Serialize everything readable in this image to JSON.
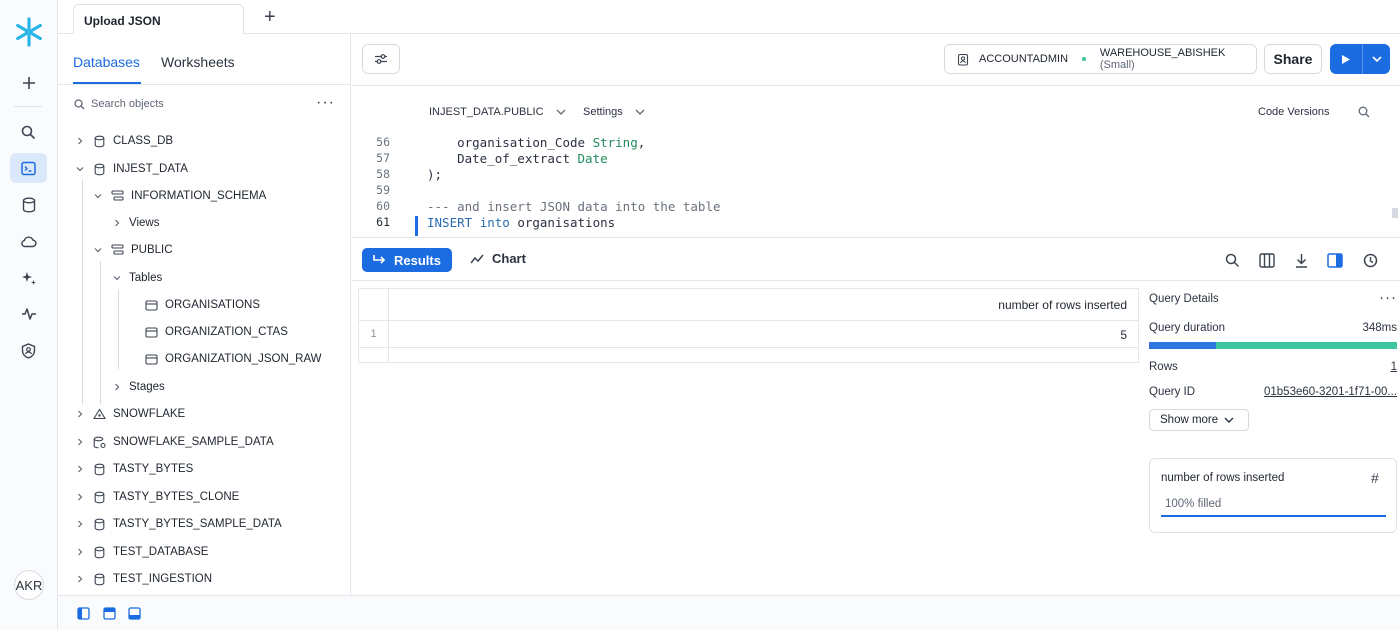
{
  "tab": {
    "title": "Upload JSON",
    "add": "+"
  },
  "panel": {
    "tabs": {
      "databases": "Databases",
      "worksheets": "Worksheets"
    },
    "search_placeholder": "Search objects",
    "more": "···",
    "tree": {
      "class_db": "CLASS_DB",
      "injest_data": "INJEST_DATA",
      "information_schema": "INFORMATION_SCHEMA",
      "views": "Views",
      "public": "PUBLIC",
      "tables": "Tables",
      "organisations": "ORGANISATIONS",
      "organization_ctas": "ORGANIZATION_CTAS",
      "organization_json_raw": "ORGANIZATION_JSON_RAW",
      "stages": "Stages",
      "snowflake": "SNOWFLAKE",
      "snowflake_sample_data": "SNOWFLAKE_SAMPLE_DATA",
      "tasty_bytes": "TASTY_BYTES",
      "tasty_bytes_clone": "TASTY_BYTES_CLONE",
      "tasty_bytes_sample_data": "TASTY_BYTES_SAMPLE_DATA",
      "test_database": "TEST_DATABASE",
      "test_ingestion": "TEST_INGESTION"
    }
  },
  "user": {
    "initials": "AKR"
  },
  "toolbar": {
    "role": "ACCOUNTADMIN",
    "warehouse": "WAREHOUSE_ABISHEK",
    "warehouse_size": "(Small)",
    "share": "Share"
  },
  "editor": {
    "context": "INJEST_DATA.PUBLIC",
    "settings": "Settings",
    "code_versions": "Code Versions",
    "lines": [
      {
        "num": "56",
        "a": "    organisation_Code ",
        "b": "String",
        "c": ","
      },
      {
        "num": "57",
        "a": "    Date_of_extract ",
        "b": "Date",
        "c": ""
      },
      {
        "num": "58",
        "text": ");"
      },
      {
        "num": "59",
        "text": ""
      },
      {
        "num": "60",
        "comment": "--- and insert JSON data into the table"
      },
      {
        "num": "61",
        "kw1": "INSERT",
        "kw2": "into",
        "rest": "organisations"
      }
    ]
  },
  "results": {
    "results_label": "Results",
    "chart_label": "Chart",
    "column_header": "number of rows inserted",
    "row_index": "1",
    "row_value": "5"
  },
  "details": {
    "title": "Query Details",
    "more": "···",
    "duration_label": "Query duration",
    "duration_value": "348ms",
    "duration_split_fraction": 0.27,
    "rows_label": "Rows",
    "rows_value": "1",
    "query_id_label": "Query ID",
    "query_id_value": "01b53e60-3201-1f71-00...",
    "show_more": "Show more",
    "column_card": {
      "title": "number of rows inserted",
      "filled": "100% filled",
      "fill_fraction": 1.0
    }
  },
  "colors": {
    "accent": "#1a6ce0",
    "bar_primary": "#2f77de",
    "bar_secondary": "#3fc5a0",
    "logo": "#29b5e8"
  }
}
